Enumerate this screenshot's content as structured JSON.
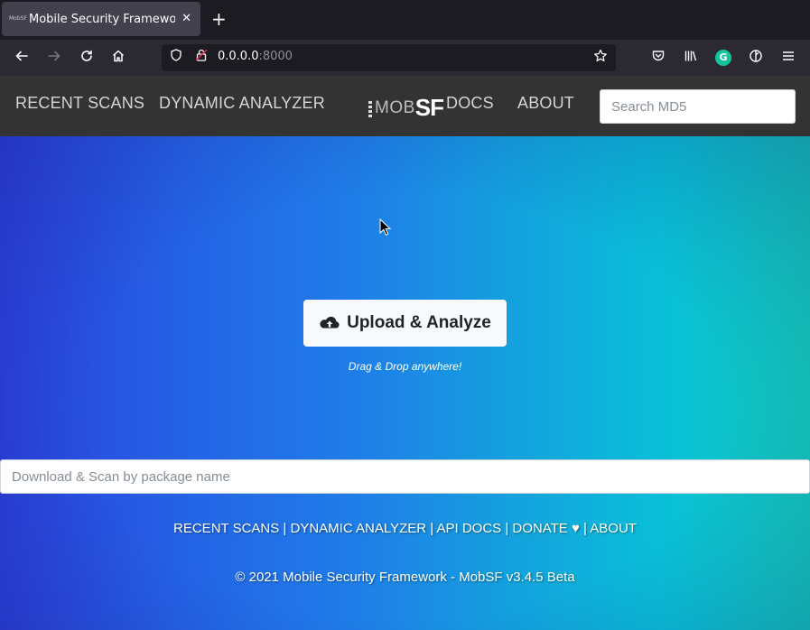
{
  "browser": {
    "tab": {
      "title": "Mobile Security Framework",
      "favicon_text": "MobSF"
    },
    "url": {
      "host": "0.0.0.0",
      "port": ":8000"
    }
  },
  "navbar": {
    "links": [
      "RECENT SCANS",
      "DYNAMIC ANALYZER",
      "DOCS",
      "ABOUT"
    ],
    "logo": {
      "mob": "MOB",
      "sf": "SF"
    },
    "search_placeholder": "Search MD5"
  },
  "main": {
    "upload_label": "Upload & Analyze",
    "drag_hint": "Drag & Drop anywhere!",
    "package_placeholder": "Download & Scan by package name"
  },
  "footer": {
    "links": [
      "RECENT SCANS",
      "DYNAMIC ANALYZER",
      "API DOCS",
      "DONATE ♥",
      "ABOUT"
    ],
    "separator": " | ",
    "copyright": "© 2021 Mobile Security Framework - MobSF v3.4.5 Beta"
  },
  "colors": {
    "navbar_bg": "#333333",
    "gradient_left": "#2b40da",
    "gradient_right": "#13c9ba",
    "button_bg": "#f8f9fa"
  }
}
